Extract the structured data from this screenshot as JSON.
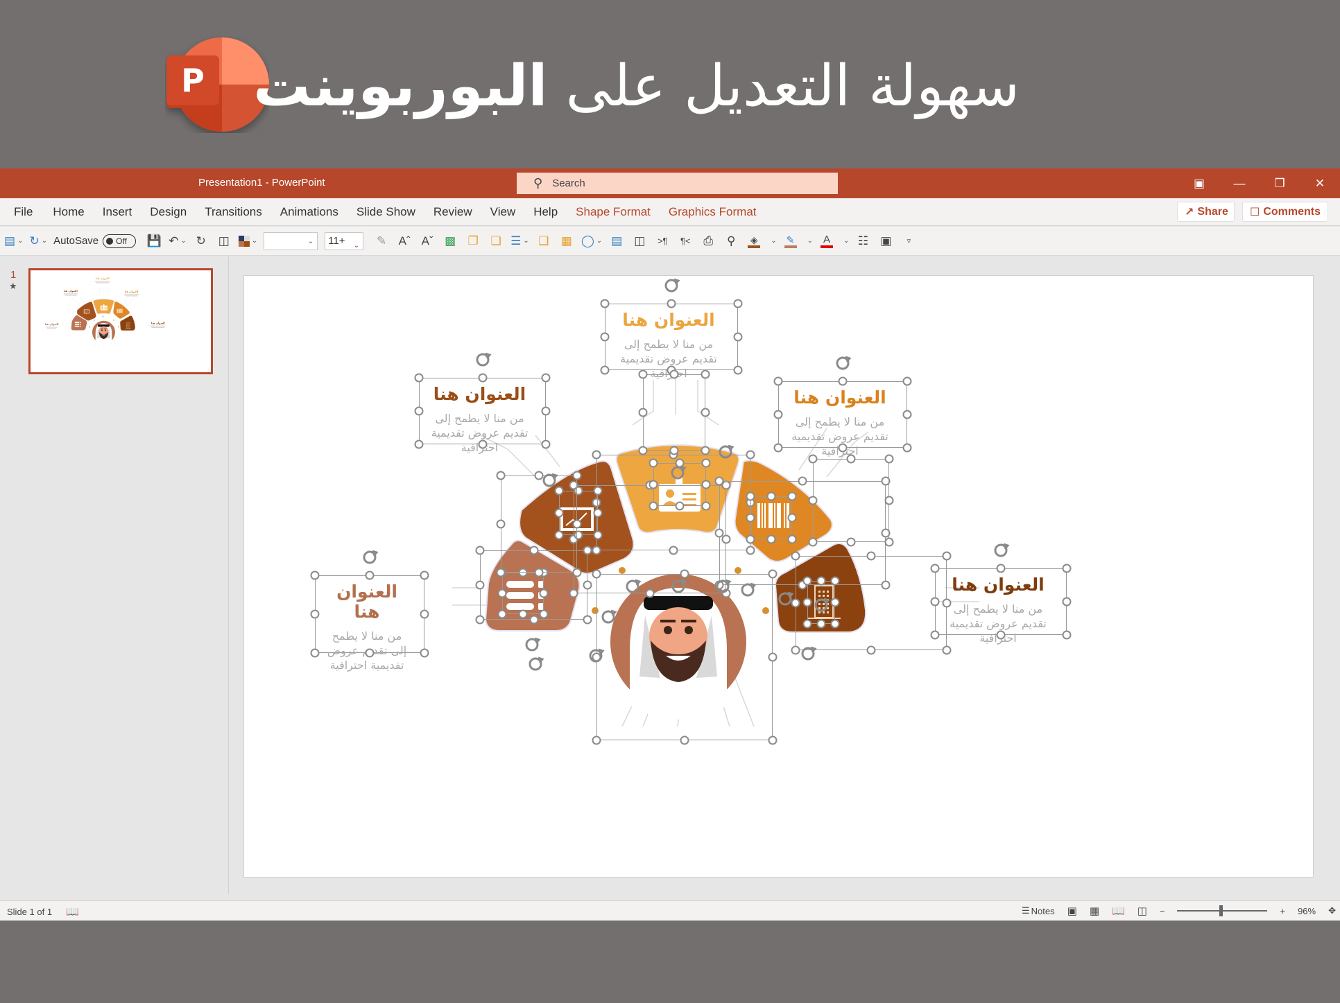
{
  "banner": {
    "title_regular": "سهولة التعديل على ",
    "title_bold": "البوربوينت",
    "logo_letter": "P",
    "logo_colors": {
      "dark": "#c43e1c",
      "mid": "#ed6c47",
      "light": "#ff8f6b",
      "back": "#d35230"
    }
  },
  "window": {
    "title": "Presentation1  -  PowerPoint",
    "search_placeholder": "Search",
    "controls": {
      "ribbon_display": "ribbon-display-icon",
      "minimize": "minimize-icon",
      "restore": "restore-icon",
      "close": "close-icon"
    },
    "accent_color": "#b7472a"
  },
  "menu": {
    "items": [
      "File",
      "Home",
      "Insert",
      "Design",
      "Transitions",
      "Animations",
      "Slide Show",
      "Review",
      "View",
      "Help"
    ],
    "context_items": [
      "Shape Format",
      "Graphics Format"
    ],
    "share_label": "Share",
    "comments_label": "Comments"
  },
  "toolbar": {
    "autosave_label": "AutoSave",
    "autosave_state": "Off",
    "font_name": "",
    "font_size": "11+",
    "icons": [
      "align-icon",
      "rotate-icon",
      "save-icon",
      "undo-icon",
      "redo-icon",
      "start-slideshow-icon",
      "theme-colors-icon",
      "format-painter-icon",
      "increase-font-icon",
      "decrease-font-icon",
      "align-center-icon",
      "bring-forward-icon",
      "send-backward-icon",
      "bullets-icon",
      "bring-to-front-icon",
      "group-icon",
      "shapes-icon",
      "text-box-icon",
      "presenter-icon",
      "ltr-icon",
      "rtl-icon",
      "replace-icon",
      "find-icon",
      "fill-color-icon",
      "outline-color-icon",
      "font-color-icon",
      "selection-pane-icon",
      "crop-icon",
      "customize-toolbar-icon"
    ],
    "fill_color": "#9a5322",
    "outline_color": "#b98060",
    "font_color": "#e00000"
  },
  "slides_panel": {
    "slide_number": "1",
    "star": "★"
  },
  "slide": {
    "text_blocks": [
      {
        "id": "top",
        "heading": "العنوان هنا",
        "body": "من منا لا يطمح إلى تقديم عروض تقديمية احترافية",
        "color": "#eba53f"
      },
      {
        "id": "upper-left",
        "heading": "العنوان هنا",
        "body": "من منا لا يطمح إلى تقديم عروض تقديمية احترافية",
        "color": "#9b4e17"
      },
      {
        "id": "upper-right",
        "heading": "العنوان هنا",
        "body": "من منا لا يطمح إلى تقديم عروض تقديمية احترافية",
        "color": "#d9821d"
      },
      {
        "id": "lower-left",
        "heading": "العنوان هنا",
        "body": "من منا لا يطمح إلى تقديم عروض تقديمية احترافية",
        "color": "#b3704e"
      },
      {
        "id": "lower-right",
        "heading": "العنوان هنا",
        "body": "من منا لا يطمح إلى تقديم عروض تقديمية احترافية",
        "color": "#7e3c0e"
      }
    ],
    "segments": [
      {
        "id": "far-left",
        "icon": "list-icon",
        "color": "#b97352"
      },
      {
        "id": "left",
        "icon": "presentation-chart-icon",
        "color": "#a3521d"
      },
      {
        "id": "center",
        "icon": "id-card-icon",
        "color": "#eea740"
      },
      {
        "id": "right",
        "icon": "barcode-icon",
        "color": "#df8823"
      },
      {
        "id": "far-right",
        "icon": "building-icon",
        "color": "#8c420e"
      }
    ],
    "avatar": {
      "ring_color": "#b97352",
      "name": "avatar-arab-man"
    }
  },
  "status": {
    "slide_info": "Slide 1 of 1",
    "notes_label": "Notes",
    "zoom_level": "96%",
    "zoom_fraction": 0.48
  }
}
